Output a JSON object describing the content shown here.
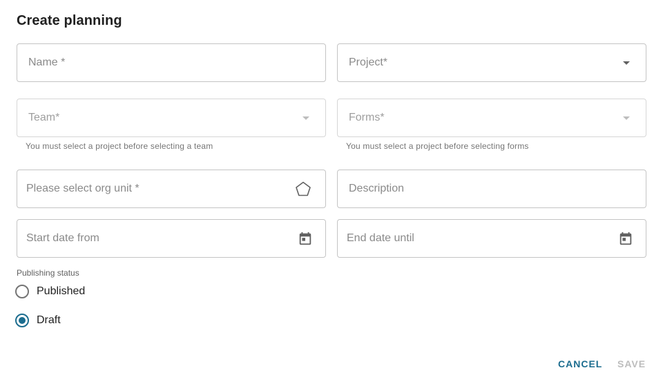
{
  "dialog": {
    "title": "Create planning"
  },
  "fields": {
    "name": {
      "placeholder": "Name *"
    },
    "project": {
      "placeholder": "Project*"
    },
    "team": {
      "placeholder": "Team*",
      "helper": "You must select a project before selecting a team"
    },
    "forms": {
      "placeholder": "Forms*",
      "helper": "You must select a project before selecting forms"
    },
    "org_unit": {
      "placeholder": "Please select org unit *"
    },
    "description": {
      "placeholder": "Description"
    },
    "start_date": {
      "placeholder": "Start date from"
    },
    "end_date": {
      "placeholder": "End date until"
    }
  },
  "publishing_status": {
    "label": "Publishing status",
    "options": [
      {
        "label": "Published",
        "selected": false
      },
      {
        "label": "Draft",
        "selected": true
      }
    ]
  },
  "actions": {
    "cancel_label": "CANCEL",
    "save_label": "SAVE"
  },
  "colors": {
    "primary": "#1c6d8f",
    "border": "#c4c4c4",
    "disabled_text": "#bdbdbd"
  },
  "icons": {
    "select": "chevron-down-icon",
    "org_unit": "pentagon-icon",
    "date": "calendar-icon"
  }
}
